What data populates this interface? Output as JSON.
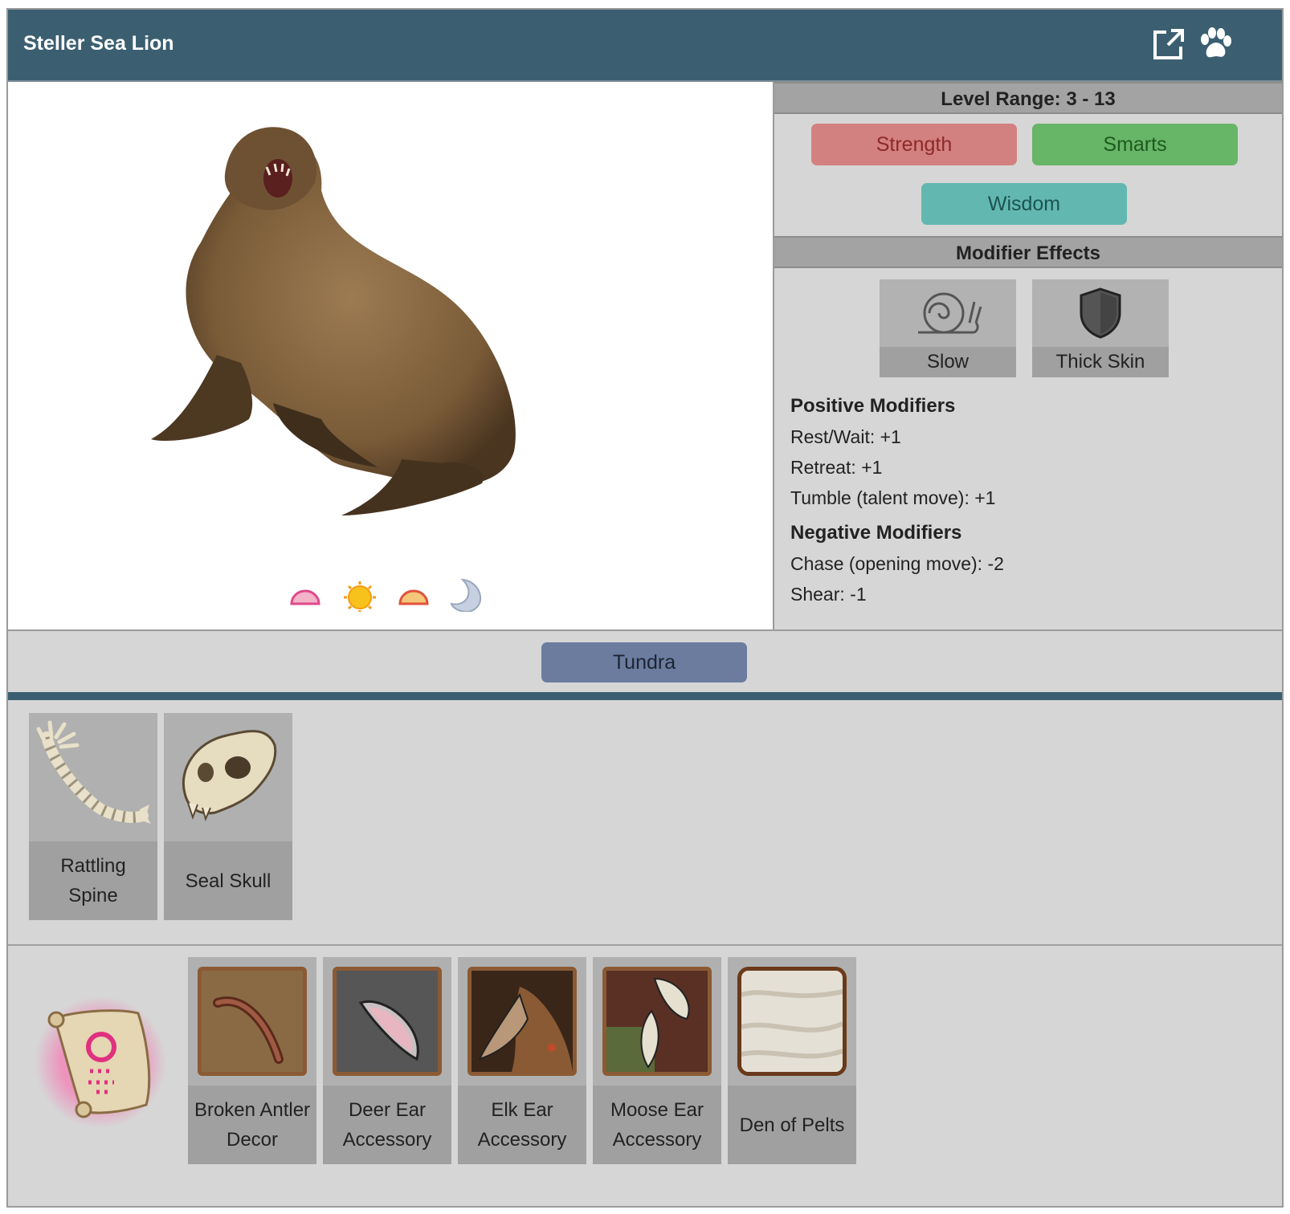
{
  "header": {
    "title": "Steller Sea Lion",
    "icons": [
      "external-link-icon",
      "paw-icon"
    ],
    "bg_color": "#3b5f71"
  },
  "animal_image": {
    "subject": "steller-sea-lion",
    "time_icons": [
      "dawn-icon",
      "day-sun-icon",
      "dusk-icon",
      "night-moon-icon"
    ]
  },
  "level": {
    "label": "Level Range: 3 - 13"
  },
  "stats": [
    {
      "label": "Strength",
      "color": "#d38080"
    },
    {
      "label": "Smarts",
      "color": "#67b567"
    },
    {
      "label": "Wisdom",
      "color": "#63b7b1"
    }
  ],
  "modifier_effects": {
    "heading": "Modifier Effects",
    "tiles": [
      {
        "label": "Slow",
        "icon": "snail-icon"
      },
      {
        "label": "Thick Skin",
        "icon": "shield-icon"
      }
    ],
    "positive_heading": "Positive Modifiers",
    "positive": [
      "Rest/Wait: +1",
      "Retreat: +1",
      "Tumble (talent move): +1"
    ],
    "negative_heading": "Negative Modifiers",
    "negative": [
      "Chase (opening move): -2",
      "Shear: -1"
    ]
  },
  "biome": {
    "label": "Tundra",
    "color": "#6b7c9f"
  },
  "drops": [
    {
      "label": "Rattling Spine",
      "icon": "spine-icon"
    },
    {
      "label": "Seal Skull",
      "icon": "skull-icon"
    }
  ],
  "rewards": {
    "scroll_icon": "scroll-icon",
    "items": [
      {
        "label": "Broken Antler Decor",
        "icon": "antler-decor-icon"
      },
      {
        "label": "Deer Ear Accessory",
        "icon": "deer-ear-icon"
      },
      {
        "label": "Elk Ear Accessory",
        "icon": "elk-ear-icon"
      },
      {
        "label": "Moose Ear Accessory",
        "icon": "moose-ear-icon"
      },
      {
        "label": "Den of Pelts",
        "icon": "pelts-icon"
      }
    ]
  }
}
